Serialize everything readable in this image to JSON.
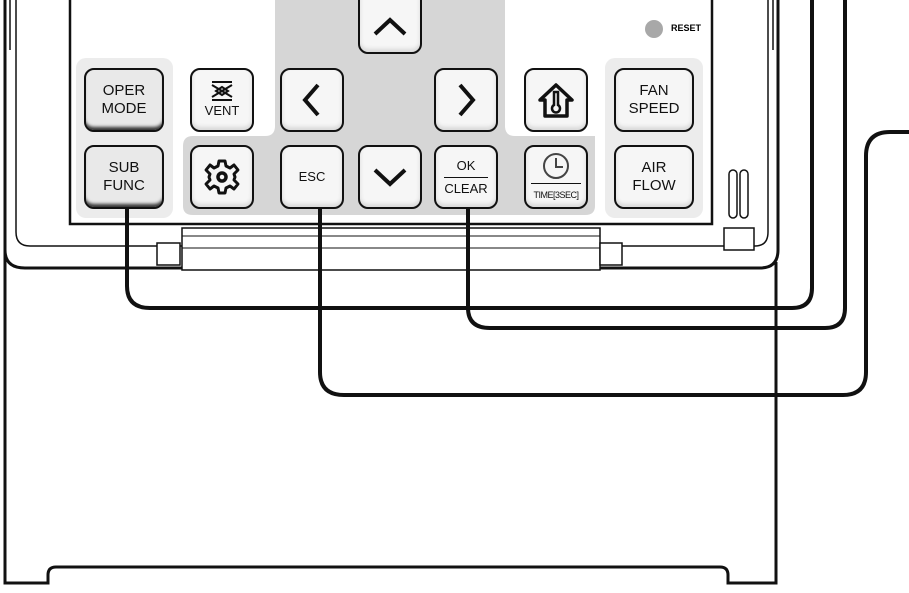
{
  "buttons": {
    "oper_mode": [
      "OPER",
      "MODE"
    ],
    "sub_func": [
      "SUB",
      "FUNC"
    ],
    "vent": "VENT",
    "esc": "ESC",
    "ok": "OK",
    "clear": "CLEAR",
    "time": "TIME[3SEC]",
    "fan_speed": [
      "FAN",
      "SPEED"
    ],
    "air_flow": [
      "AIR",
      "FLOW"
    ]
  },
  "reset_label": "RESET",
  "icons": {
    "up": "chevron-up-icon",
    "down": "chevron-down-icon",
    "left": "chevron-left-icon",
    "right": "chevron-right-icon",
    "settings": "gear-icon",
    "room_temp": "house-thermometer-icon",
    "timer": "clock-icon",
    "vent": "vent-icon"
  },
  "colors": {
    "outline": "#111111",
    "dpad_area": "#d6d6d6",
    "group_area": "#ececec",
    "reset_dot": "#a8a8a8"
  }
}
